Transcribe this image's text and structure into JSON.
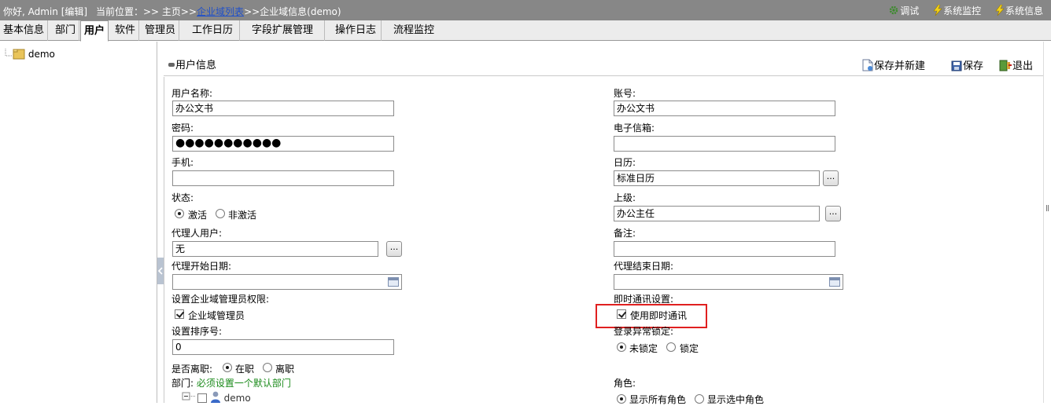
{
  "topbar": {
    "greeting": "你好, Admin [编辑]",
    "location_prefix": "当前位置：>> 主页>>",
    "location_link": "企业域列表",
    "location_suffix": ">>企业域信息(demo)",
    "tools": [
      "调试",
      "系统监控",
      "系统信息"
    ]
  },
  "tabs": [
    "基本信息",
    "部门",
    "用户",
    "软件",
    "管理员",
    "工作日历",
    "字段扩展管理",
    "操作日志",
    "流程监控"
  ],
  "active_tab": "用户",
  "tree": {
    "root": "demo"
  },
  "panel": {
    "title": "用户信息",
    "save_new_label": "保存并新建",
    "save_label": "保存",
    "exit_label": "退出"
  },
  "form": {
    "username_label": "用户名称:",
    "username_value": "办公文书",
    "account_label": "账号:",
    "account_value": "办公文书",
    "password_label": "密码:",
    "password_value": "●●●●●●●●●●●",
    "email_label": "电子信箱:",
    "email_value": "",
    "phone_label": "手机:",
    "phone_value": "",
    "calendar_label": "日历:",
    "calendar_value": "标准日历",
    "status_label": "状态:",
    "status_active": "激活",
    "status_inactive": "非激活",
    "superior_label": "上级:",
    "superior_value": "办公主任",
    "proxy_user_label": "代理人用户:",
    "proxy_user_value": "无",
    "remark_label": "备注:",
    "remark_value": "",
    "proxy_start_label": "代理开始日期:",
    "proxy_start_value": "",
    "proxy_end_label": "代理结束日期:",
    "proxy_end_value": "",
    "admin_perm_label": "设置企业域管理员权限:",
    "admin_perm_option": "企业域管理员",
    "im_label": "即时通讯设置:",
    "im_option": "使用即时通讯",
    "sort_label": "设置排序号:",
    "sort_value": "0",
    "login_lock_label": "登录异常锁定:",
    "unlocked": "未锁定",
    "locked": "锁定",
    "resigned_label": "是否离职:",
    "employed": "在职",
    "resigned": "离职",
    "dept_label": "部门:",
    "dept_note": "必须设置一个默认部门",
    "dept_node": "demo",
    "role_label": "角色:",
    "role_show_all": "显示所有角色",
    "role_show_selected": "显示选中角色",
    "picker_label": "..."
  },
  "colors": {
    "topbar": "#878787",
    "highlight_box": "#e02020",
    "link": "#2050c8",
    "note": "#1a8a1a"
  }
}
